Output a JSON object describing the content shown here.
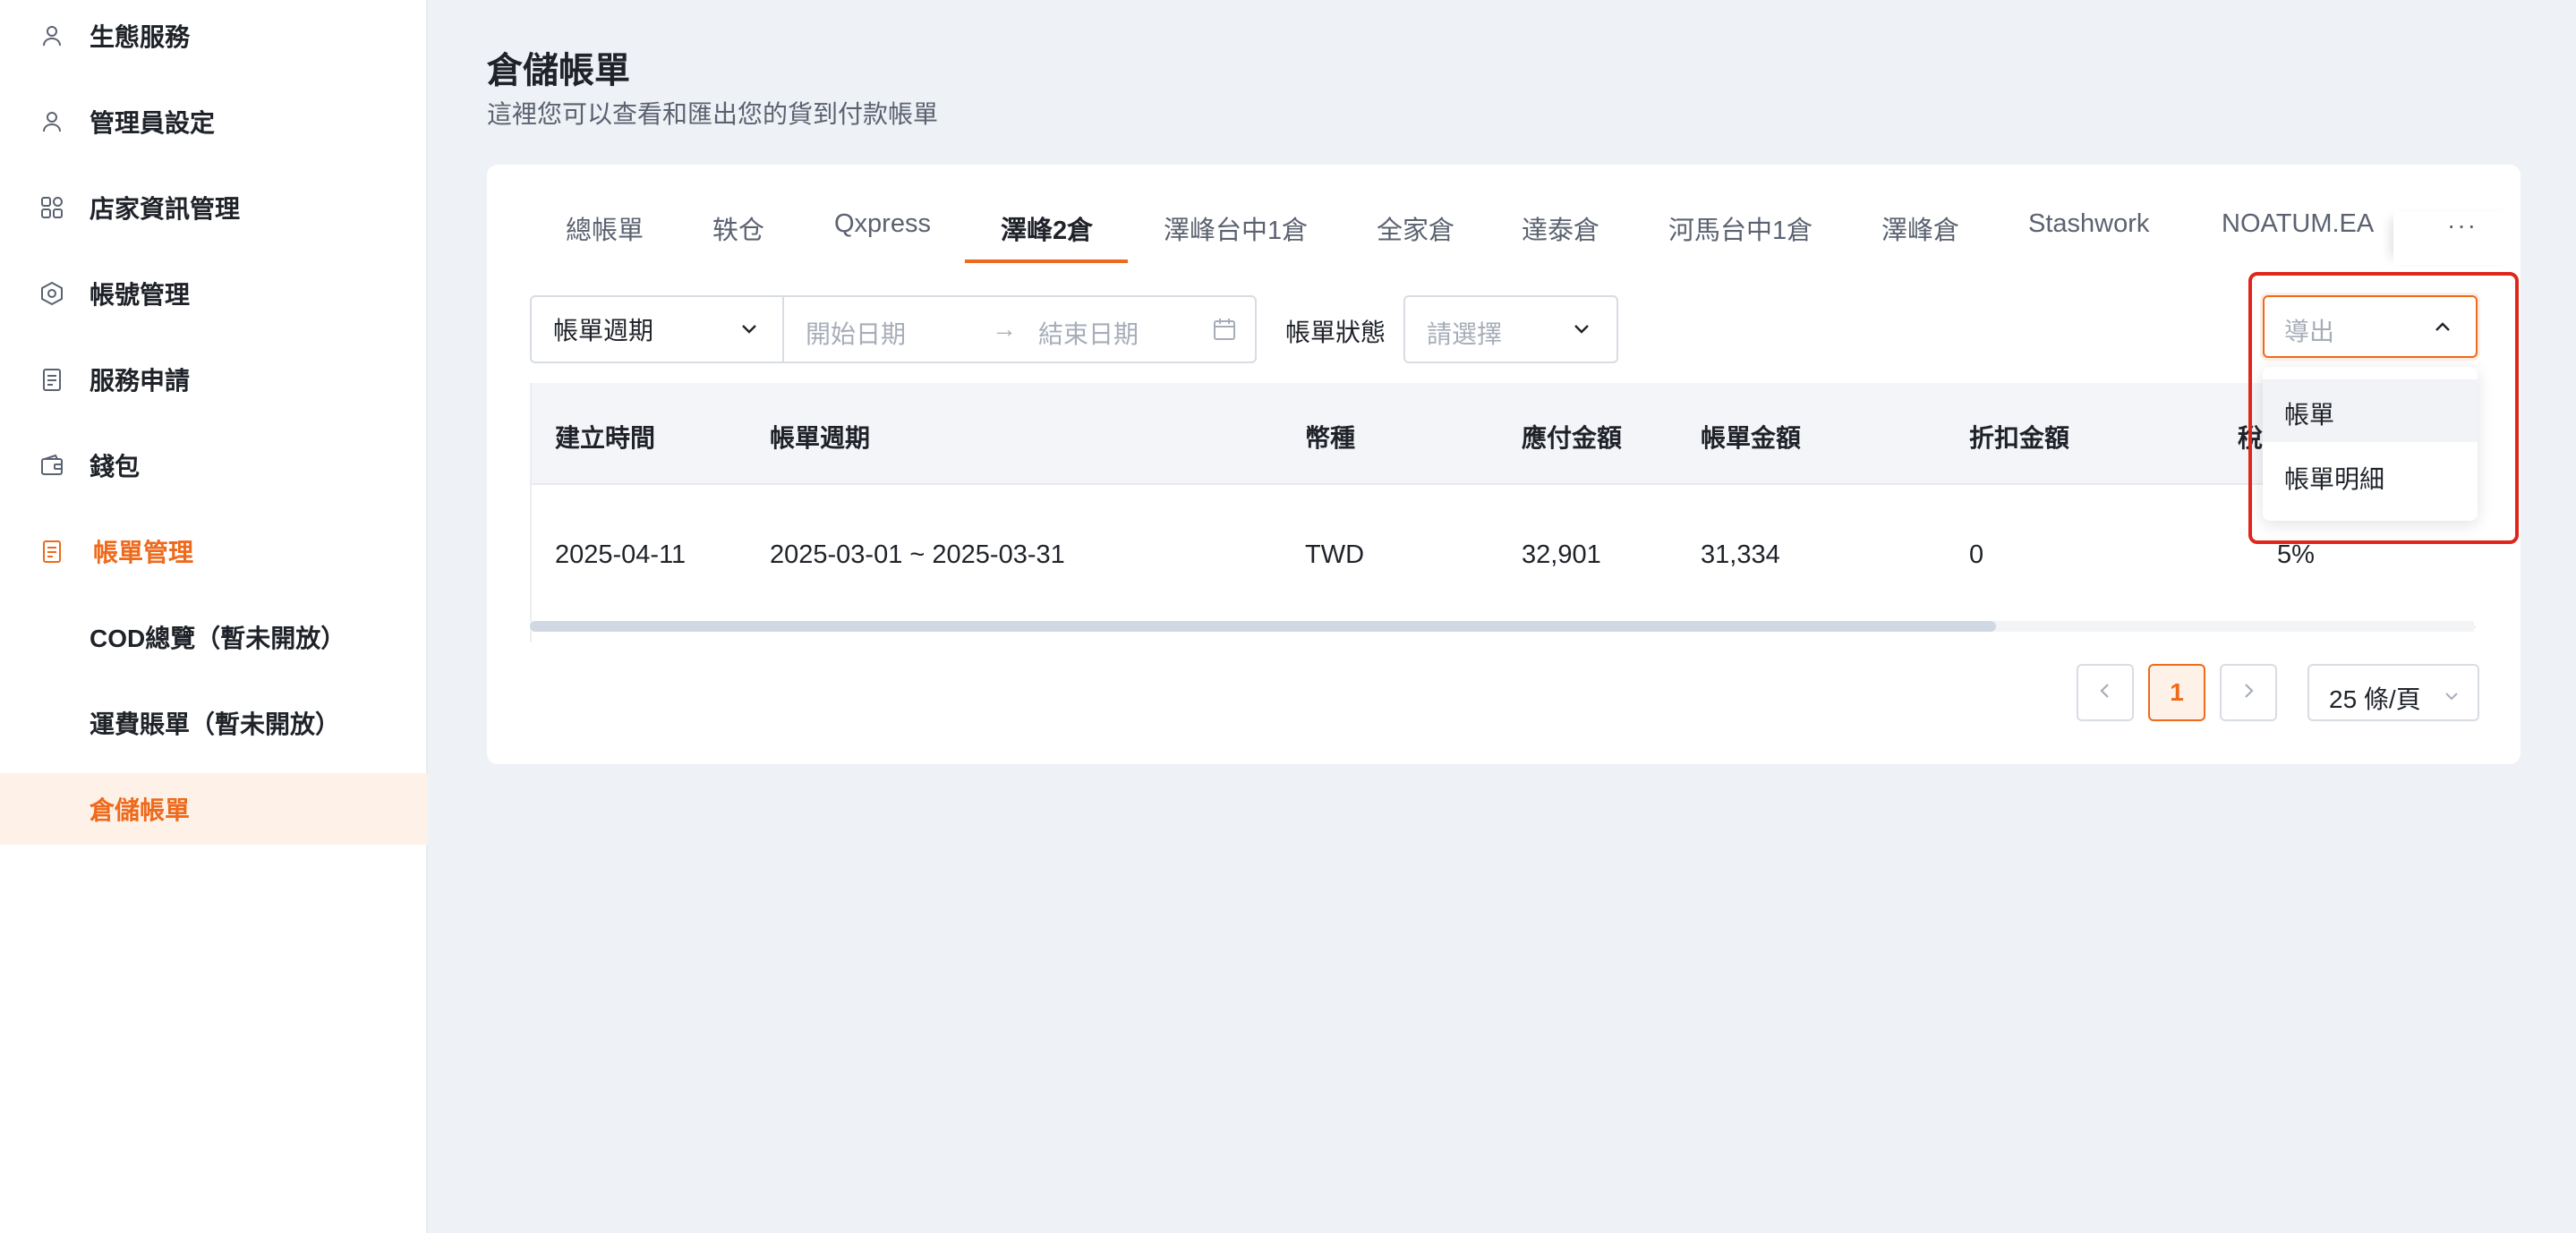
{
  "sidebar": {
    "items": [
      {
        "label": "生態服務",
        "icon": "user-icon"
      },
      {
        "label": "管理員設定",
        "icon": "user-icon"
      },
      {
        "label": "店家資訊管理",
        "icon": "grid-icon"
      },
      {
        "label": "帳號管理",
        "icon": "hexagon-icon"
      },
      {
        "label": "服務申請",
        "icon": "clipboard-icon"
      },
      {
        "label": "錢包",
        "icon": "wallet-icon"
      },
      {
        "label": "帳單管理",
        "icon": "bill-icon"
      }
    ],
    "sub_items": [
      {
        "label": "COD總覽（暫未開放）"
      },
      {
        "label": "運費賬單（暫未開放）"
      },
      {
        "label": "倉儲帳單"
      }
    ]
  },
  "header": {
    "title": "倉儲帳單",
    "subtitle": "這裡您可以查看和匯出您的貨到付款帳單"
  },
  "tabs": [
    {
      "label": "總帳單"
    },
    {
      "label": "轶仓"
    },
    {
      "label": "Qxpress"
    },
    {
      "label": "澤峰2倉"
    },
    {
      "label": "澤峰台中1倉"
    },
    {
      "label": "全家倉"
    },
    {
      "label": "達泰倉"
    },
    {
      "label": "河馬台中1倉"
    },
    {
      "label": "澤峰倉"
    },
    {
      "label": "Stashwork"
    },
    {
      "label": "NOATUM.EA"
    }
  ],
  "tabs_more": "···",
  "filters": {
    "period_select": "帳單週期",
    "start_placeholder": "開始日期",
    "arrow": "→",
    "end_placeholder": "結束日期",
    "status_label": "帳單狀態",
    "status_placeholder": "請選擇"
  },
  "table": {
    "columns": [
      "建立時間",
      "帳單週期",
      "幣種",
      "應付金額",
      "帳單金額",
      "折扣金額",
      "稅"
    ],
    "rows": [
      [
        "2025-04-11",
        "2025-03-01 ~ 2025-03-31",
        "TWD",
        "32,901",
        "31,334",
        "0",
        "5%"
      ]
    ]
  },
  "pagination": {
    "current": "1",
    "page_size": "25 條/頁"
  },
  "export": {
    "placeholder": "導出",
    "options": [
      "帳單",
      "帳單明細"
    ]
  },
  "colors": {
    "accent": "#ee6a1c",
    "highlight": "#e0261b"
  }
}
